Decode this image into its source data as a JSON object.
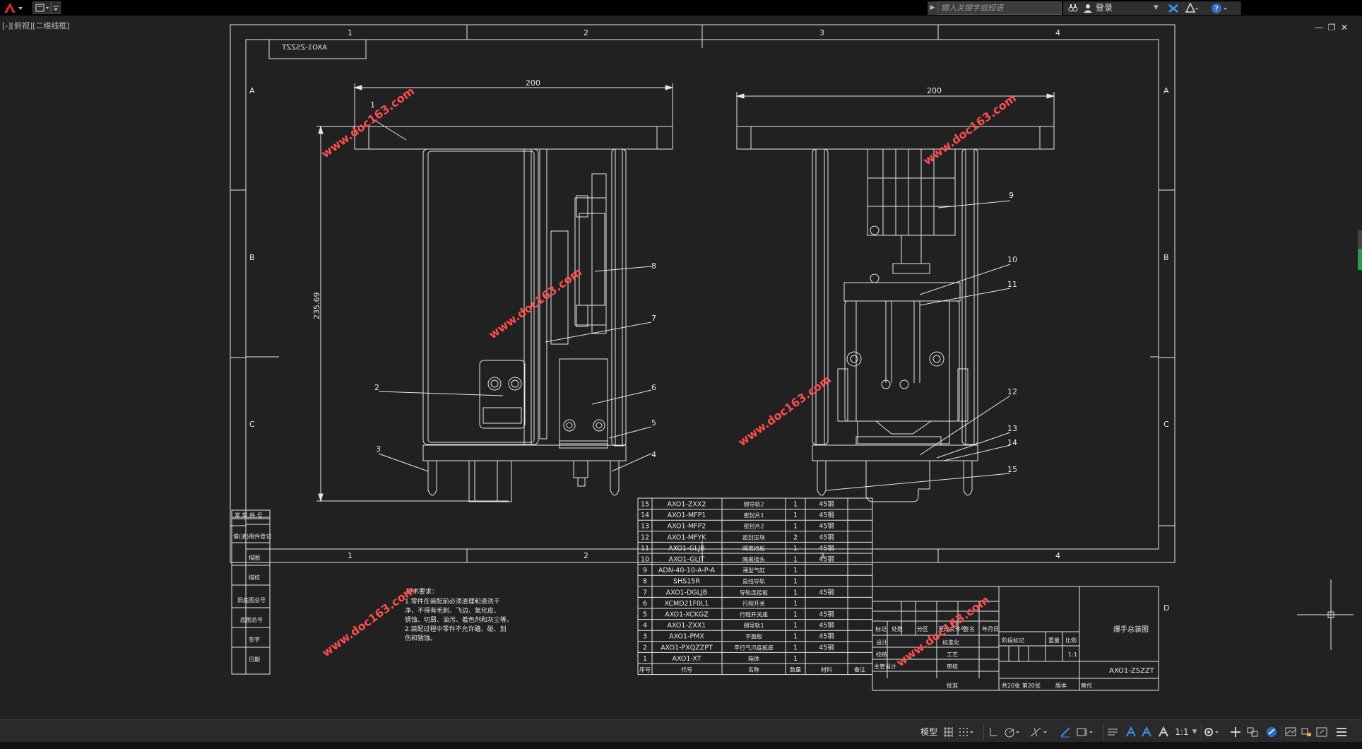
{
  "titlebar": {
    "search_placeholder": "键入关键字或短语",
    "login_label": "登录"
  },
  "viewport_label": "[-][俯视][二维线框]",
  "drawing": {
    "column_labels": [
      "1",
      "2",
      "3",
      "4"
    ],
    "row_labels": [
      "A",
      "B",
      "C",
      "D"
    ],
    "mirrored_stamp": "AXO1-ZSZZT",
    "dim_left_width": "200",
    "dim_left_height": "235.69",
    "dim_right_width": "200",
    "balloons_left": [
      "1",
      "2",
      "3",
      "4",
      "5",
      "6",
      "7",
      "8"
    ],
    "balloons_right": [
      "9",
      "10",
      "11",
      "12",
      "13",
      "14",
      "15"
    ],
    "watermark": "www.doc163.com",
    "left_strip_labels": [
      "借(通)用件登记",
      "描图",
      "描校",
      "旧底图总号",
      "底图总号",
      "签字",
      "日期"
    ],
    "left_strip_top": "常 常 件 号",
    "tech_notes": {
      "title": "技术要求：",
      "lines": [
        "1.零件在装配前必须清理和清洗干",
        "净，不得有毛刺、飞边、氧化皮、",
        "锈蚀、切屑、油污、着色剂和灰尘等。",
        "2.装配过程中零件不允许磕、碰、划",
        "伤和锈蚀。"
      ]
    },
    "bom": {
      "header": [
        "序号",
        "代号",
        "名称",
        "数量",
        "材料",
        "备注"
      ],
      "rows": [
        [
          "15",
          "AXO1-ZXX2",
          "侧导轨2",
          "1",
          "45钢",
          ""
        ],
        [
          "14",
          "AXO1-MFP1",
          "密封片1",
          "1",
          "45钢",
          ""
        ],
        [
          "13",
          "AXO1-MFP2",
          "密封片2",
          "1",
          "45钢",
          ""
        ],
        [
          "12",
          "AXO1-MFYK",
          "密封压块",
          "2",
          "45钢",
          ""
        ],
        [
          "11",
          "AXO1-GLJB",
          "隔离挡板",
          "1",
          "45钢",
          ""
        ],
        [
          "10",
          "AXO1-GLJT",
          "隔离接头",
          "1",
          "45钢",
          ""
        ],
        [
          "9",
          "ADN-40-10-A-P-A",
          "薄型气缸",
          "1",
          "",
          ""
        ],
        [
          "8",
          "SHS15R",
          "直线导轨",
          "1",
          "",
          ""
        ],
        [
          "7",
          "AXO1-DGLJB",
          "导轨连接板",
          "1",
          "45钢",
          ""
        ],
        [
          "6",
          "XCMD21F0L1",
          "行程开关",
          "1",
          "",
          ""
        ],
        [
          "5",
          "AXO1-XCKGZ",
          "行程开关座",
          "1",
          "45钢",
          ""
        ],
        [
          "4",
          "AXO1-ZXX1",
          "侧导轨1",
          "1",
          "45钢",
          ""
        ],
        [
          "3",
          "AXO1-PMX",
          "平面板",
          "1",
          "45钢",
          ""
        ],
        [
          "2",
          "AXO1-PXQZZPT",
          "平行气爪底板座",
          "1",
          "45钢",
          ""
        ],
        [
          "1",
          "AXO1-XT",
          "箱体",
          "1",
          "",
          ""
        ]
      ]
    },
    "title_block": {
      "sign_row": [
        "标记",
        "处数",
        "分区",
        "更改文件号",
        "签名",
        "年月日"
      ],
      "sign_labels": [
        "设计",
        "校核",
        "主管设计"
      ],
      "process_labels": [
        "标准化",
        "工艺",
        "审核",
        "批准"
      ],
      "stage_labels": [
        "阶段标记",
        "重量",
        "比例"
      ],
      "scale": "1:1",
      "drawing_name": "爆手总装图",
      "drawing_number": "AXO1-ZSZZT",
      "sheet_info": "共20张 第20张",
      "version": "版本",
      "replaces": "替代"
    }
  },
  "statusbar": {
    "model_label": "模型",
    "scale_label": "1:1"
  }
}
